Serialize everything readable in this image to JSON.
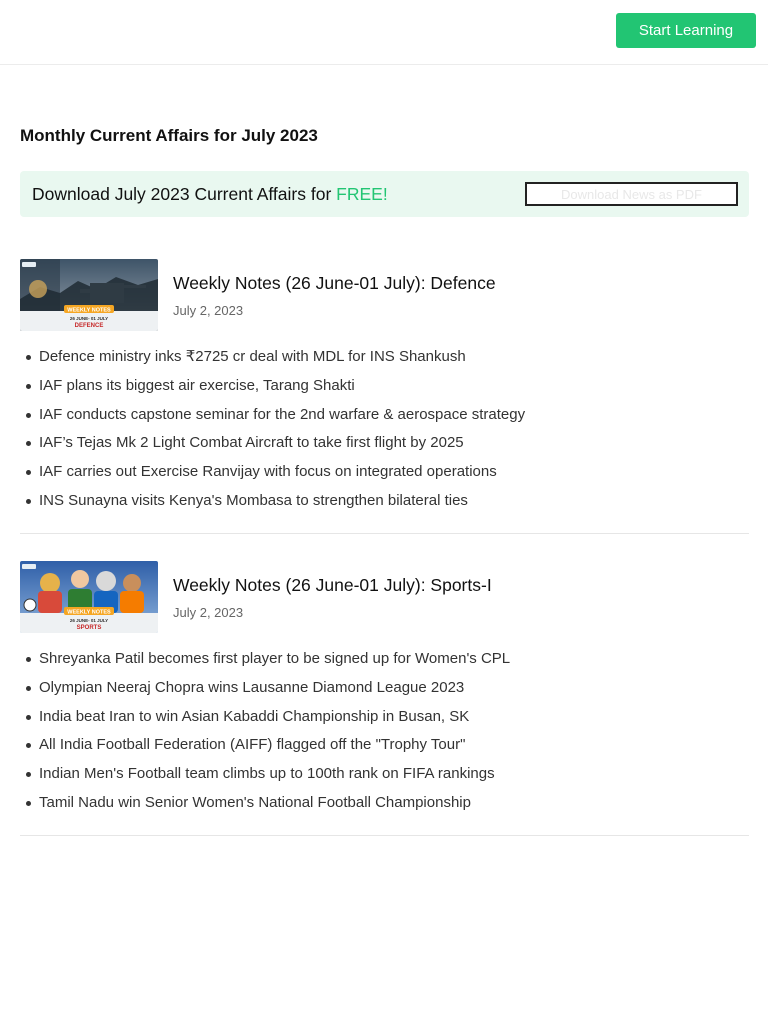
{
  "header": {
    "start_button_label": "Start Learning"
  },
  "page": {
    "title": "Monthly Current Affairs for July 2023"
  },
  "banner": {
    "text": "Download July 2023 Current Affairs for ",
    "free_label": "FREE!",
    "pdf_button_label": "Download News as PDF"
  },
  "articles": [
    {
      "title": "Weekly Notes (26 June-01 July): Defence",
      "date": "July 2, 2023",
      "thumbnail": {
        "badge": "WEEKLY NOTES",
        "dates": "26 JUNE- 01 JULY",
        "topic": "DEFENCE"
      },
      "bullets": [
        "Defence ministry inks ₹2725 cr deal with MDL for INS Shankush",
        "IAF plans its biggest air exercise, Tarang Shakti",
        "IAF conducts capstone seminar for the 2nd warfare & aerospace strategy",
        "IAF’s Tejas Mk 2 Light Combat Aircraft to take first flight by 2025",
        "IAF carries out Exercise Ranvijay with focus on integrated operations",
        "INS Sunayna visits Kenya's Mombasa to strengthen bilateral ties"
      ]
    },
    {
      "title": "Weekly Notes (26 June-01 July): Sports-I",
      "date": "July 2, 2023",
      "thumbnail": {
        "badge": "WEEKLY NOTES",
        "dates": "26 JUNE- 01 JULY",
        "topic": "SPORTS"
      },
      "bullets": [
        "Shreyanka Patil becomes first player to be signed up for Women's CPL",
        "Olympian Neeraj Chopra wins Lausanne Diamond League 2023",
        "India beat Iran to win Asian Kabaddi Championship in Busan, SK",
        "All India Football Federation (AIFF) flagged off the \"Trophy Tour\"",
        "Indian Men's Football team climbs up to 100th rank on FIFA rankings",
        "Tamil Nadu win Senior Women's National Football Championship"
      ]
    }
  ],
  "colors": {
    "accent_green": "#22c573",
    "banner_bg": "#e9f8f0",
    "badge_orange": "#f5a623",
    "topic_red": "#c62828"
  }
}
